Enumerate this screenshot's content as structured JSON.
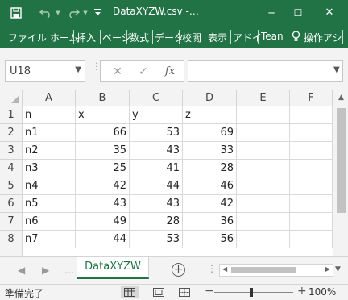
{
  "window": {
    "title": "DataXYZW.csv -…",
    "controls": {
      "minimize": "─",
      "maximize": "☐",
      "close": "✕"
    }
  },
  "ribbon": {
    "tabs": [
      "ファイル",
      "ホーム",
      "挿入",
      "ページ",
      "数式",
      "データ",
      "校閲",
      "表示",
      "アドイ",
      "Tean"
    ],
    "tell_me": "操作アシ"
  },
  "formula_bar": {
    "name_box": "U18",
    "fx_label": "fx",
    "formula": ""
  },
  "grid": {
    "columns": [
      "A",
      "B",
      "C",
      "D",
      "E",
      "F"
    ],
    "rows": [
      {
        "num": "1",
        "cells": [
          "n",
          "x",
          "y",
          "z",
          "",
          ""
        ]
      },
      {
        "num": "2",
        "cells": [
          "n1",
          "66",
          "53",
          "69",
          "",
          ""
        ]
      },
      {
        "num": "3",
        "cells": [
          "n2",
          "35",
          "43",
          "33",
          "",
          ""
        ]
      },
      {
        "num": "4",
        "cells": [
          "n3",
          "25",
          "41",
          "28",
          "",
          ""
        ]
      },
      {
        "num": "5",
        "cells": [
          "n4",
          "42",
          "44",
          "46",
          "",
          ""
        ]
      },
      {
        "num": "6",
        "cells": [
          "n5",
          "43",
          "43",
          "42",
          "",
          ""
        ]
      },
      {
        "num": "7",
        "cells": [
          "n6",
          "49",
          "28",
          "36",
          "",
          ""
        ]
      },
      {
        "num": "8",
        "cells": [
          "n7",
          "44",
          "53",
          "56",
          "",
          ""
        ]
      }
    ]
  },
  "sheets": {
    "active": "DataXYZW",
    "add_label": "+"
  },
  "status": {
    "text": "準備完了",
    "zoom": "100%",
    "zoom_minus": "−",
    "zoom_plus": "+"
  },
  "colors": {
    "brand": "#217346",
    "chrome": "#f3f3f3"
  }
}
